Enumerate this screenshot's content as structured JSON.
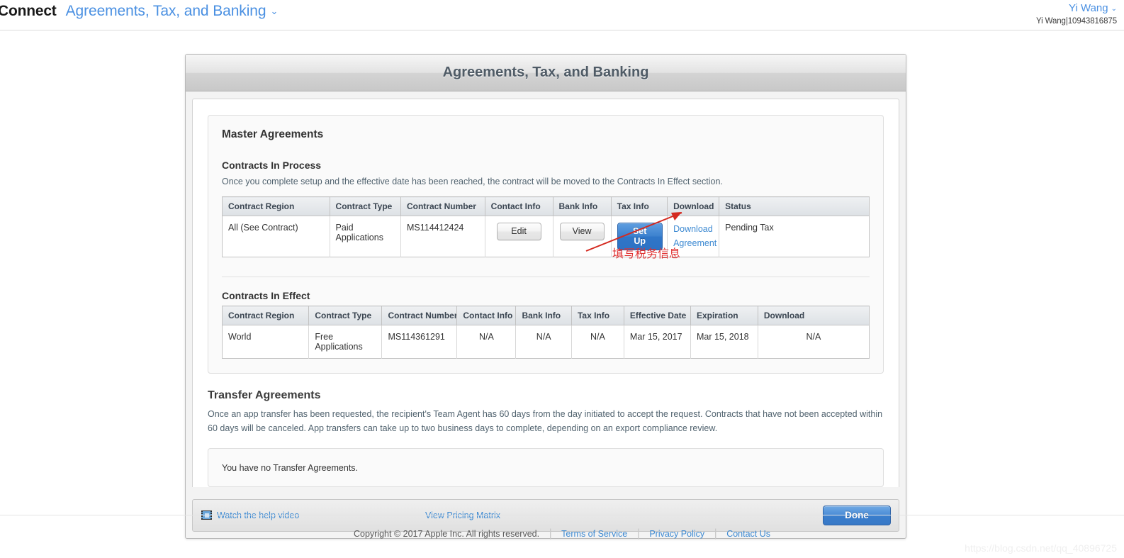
{
  "topnav": {
    "brand": "Connect",
    "section_title": "Agreements, Tax, and Banking",
    "chevron": "⌄",
    "user_name": "Yi Wang",
    "user_chevron": "⌄",
    "user_team": "Yi Wang|10943816875"
  },
  "module": {
    "title": "Agreements, Tax, and Banking"
  },
  "master": {
    "heading": "Master Agreements",
    "in_process": {
      "heading": "Contracts In Process",
      "description": "Once you complete setup and the effective date has been reached, the contract will be moved to the Contracts In Effect section.",
      "columns": [
        "Contract Region",
        "Contract Type",
        "Contract Number",
        "Contact Info",
        "Bank Info",
        "Tax Info",
        "Download",
        "Status"
      ],
      "row": {
        "contract_region": "All (See Contract)",
        "contract_type": "Paid Applications",
        "contract_number": "MS114412424",
        "contact_info_button": "Edit",
        "bank_info_button": "View",
        "tax_info_button": "Set Up",
        "download_line1": "Download",
        "download_line2": "Agreement",
        "status": "Pending Tax"
      }
    },
    "in_effect": {
      "heading": "Contracts In Effect",
      "columns": [
        "Contract Region",
        "Contract Type",
        "Contract Number",
        "Contact Info",
        "Bank Info",
        "Tax Info",
        "Effective Date",
        "Expiration",
        "Download"
      ],
      "row": {
        "contract_region": "World",
        "contract_type": "Free Applications",
        "contract_number": "MS114361291",
        "contact_info": "N/A",
        "bank_info": "N/A",
        "tax_info": "N/A",
        "effective_date": "Mar 15, 2017",
        "expiration": "Mar 15, 2018",
        "download": "N/A"
      }
    }
  },
  "transfer": {
    "heading": "Transfer Agreements",
    "description": "Once an app transfer has been requested, the recipient's Team Agent has 60 days from the day initiated to accept the request. Contracts that have not been accepted within 60 days will be canceled. App transfers can take up to two business days to complete, depending on an export compliance review.",
    "empty_message": "You have no Transfer Agreements."
  },
  "module_footer": {
    "help_video": "Watch the help video",
    "pricing_matrix": "View Pricing Matrix",
    "done": "Done"
  },
  "page_footer": {
    "copyright": "Copyright © 2017 Apple Inc. All rights reserved.",
    "terms": "Terms of Service",
    "privacy": "Privacy Policy",
    "contact": "Contact Us",
    "separator": "|"
  },
  "annotation": {
    "text": "填写税务信息",
    "color": "#e03030"
  },
  "watermark": {
    "text": "https://blog.csdn.net/qq_40896725"
  }
}
